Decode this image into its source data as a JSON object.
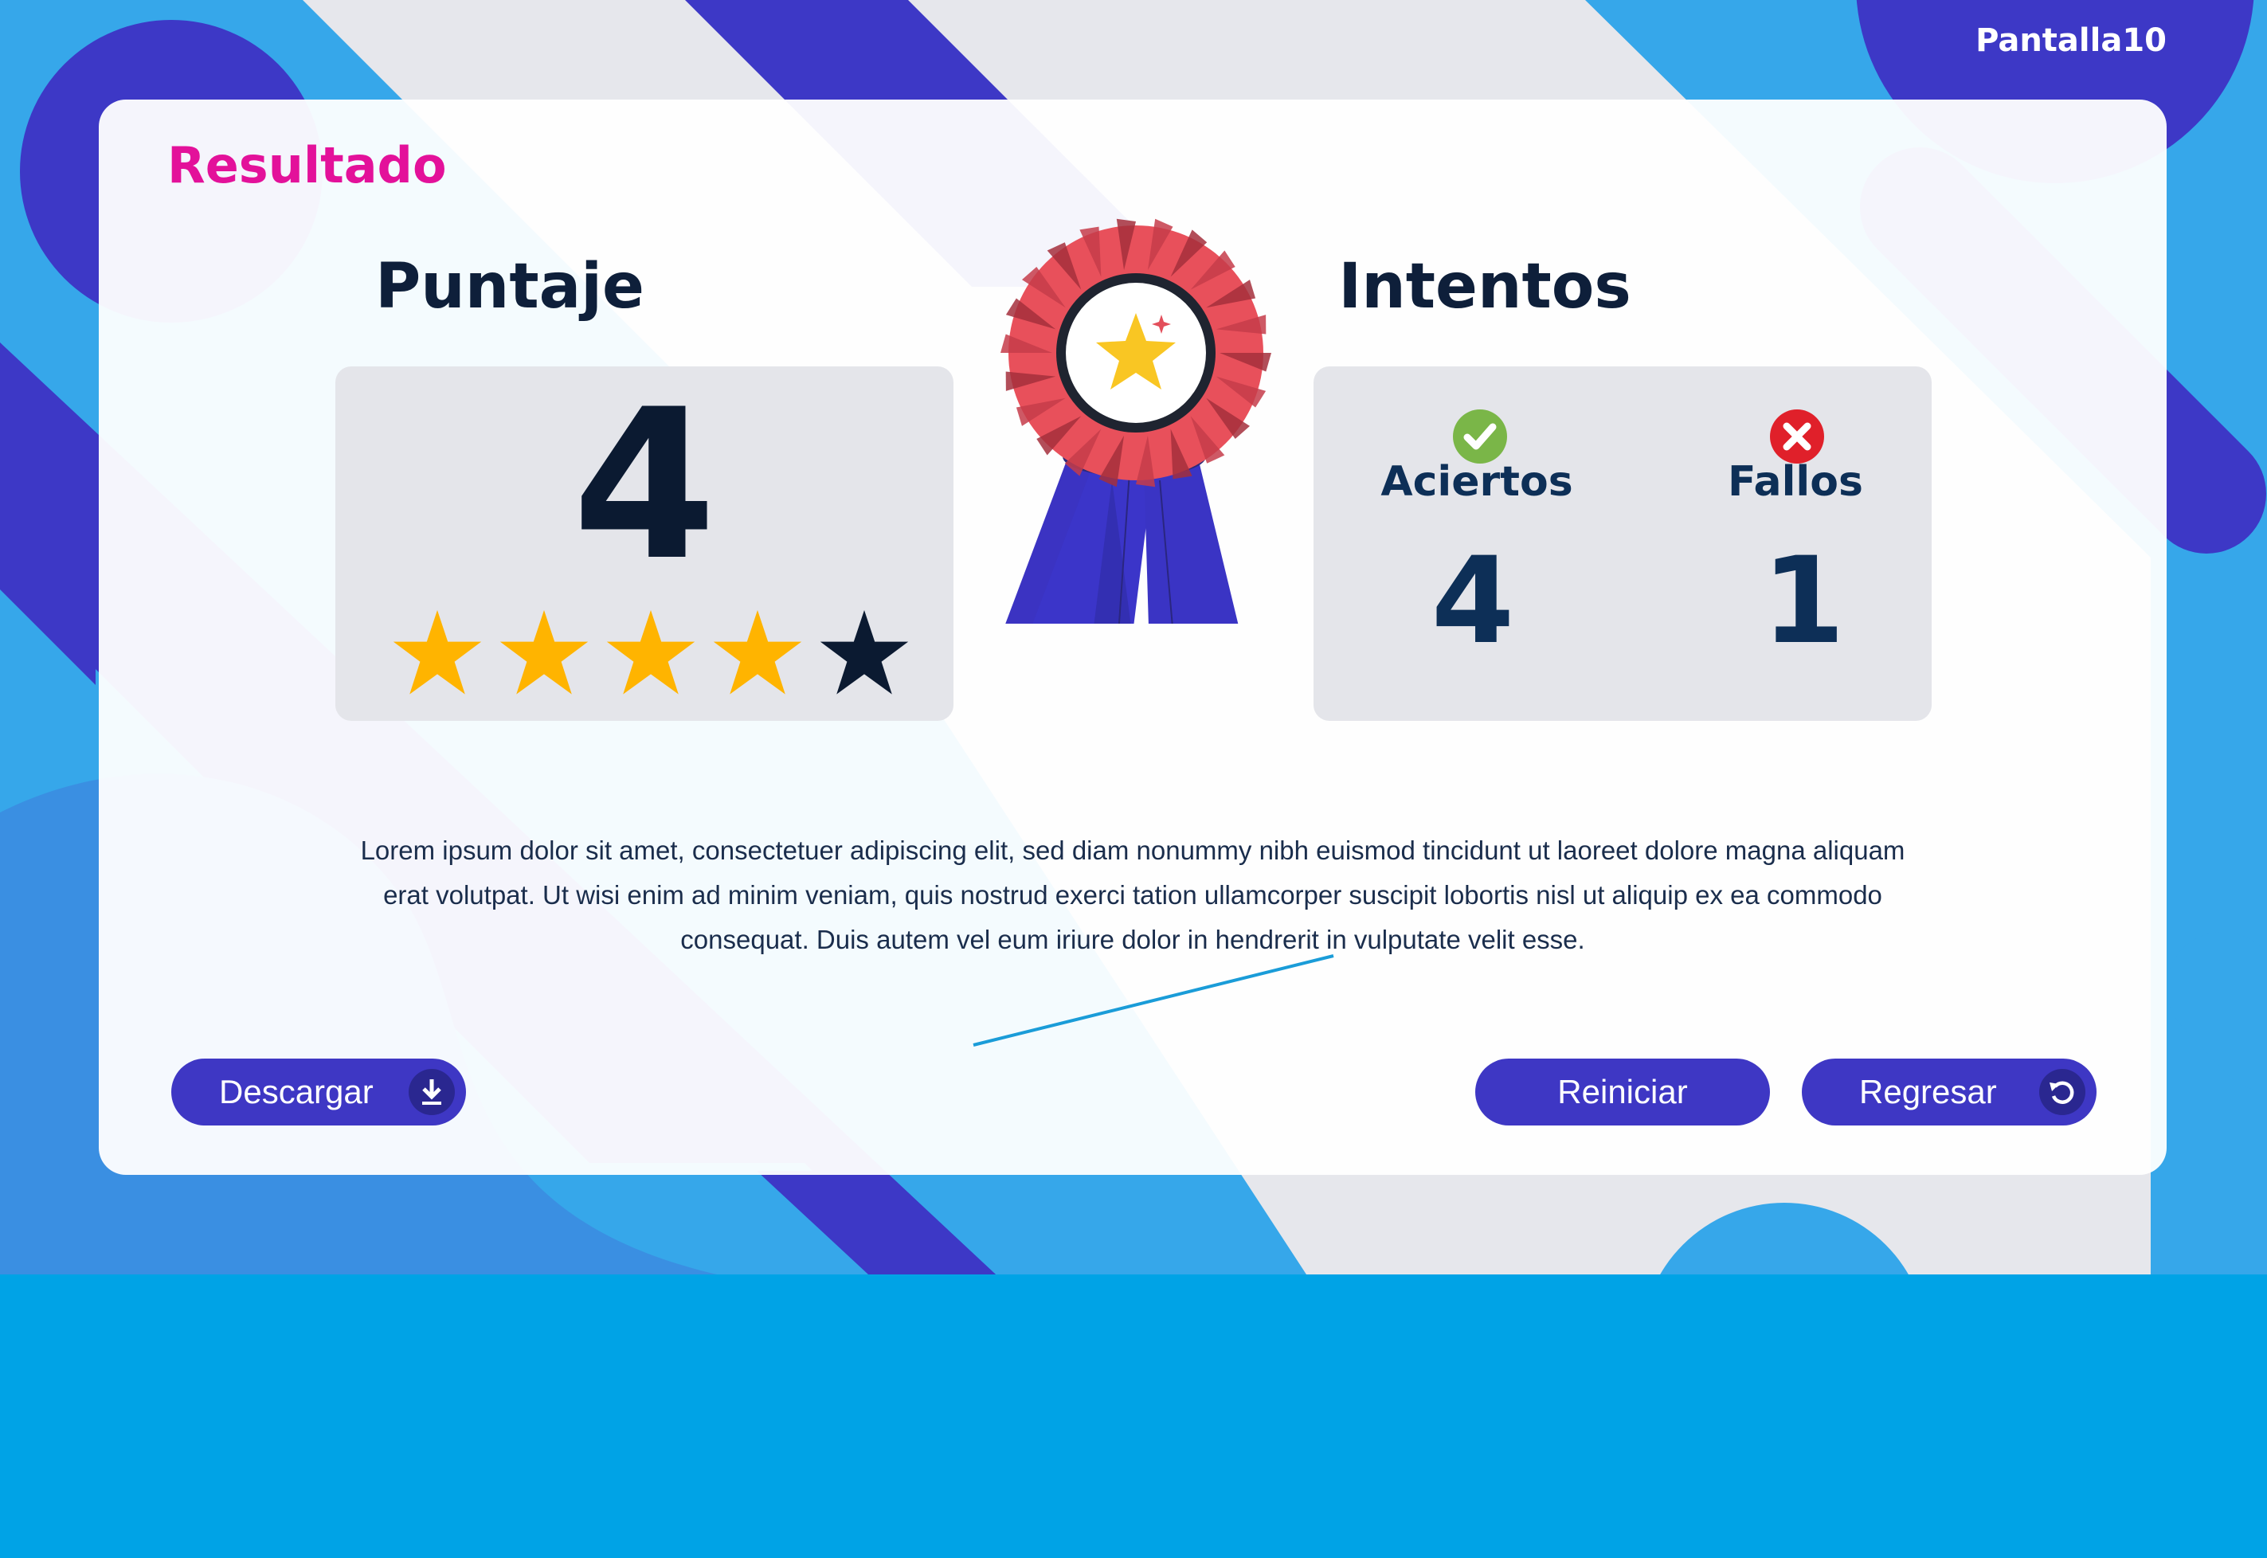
{
  "screen": {
    "label": "Pantalla10"
  },
  "card": {
    "title": "Resultado"
  },
  "score": {
    "title": "Puntaje",
    "value": "4",
    "stars_filled": 4,
    "stars_total": 5,
    "star_filled_color": "#ffb400",
    "star_empty_color": "#0b1a31"
  },
  "attempts": {
    "title": "Intentos",
    "correct": {
      "label": "Aciertos",
      "value": "4",
      "icon": "check-circle-icon",
      "color": "#7ab648"
    },
    "wrong": {
      "label": "Fallos",
      "value": "1",
      "icon": "x-circle-icon",
      "color": "#e0202a"
    }
  },
  "award": {
    "icon": "award-ribbon-icon"
  },
  "message": "Lorem ipsum dolor sit amet, consectetuer adipiscing elit, sed diam nonummy nibh euismod tincidunt ut laoreet dolore magna aliquam erat volutpat. Ut wisi enim ad minim veniam, quis nostrud exerci tation ullamcorper suscipit lobortis nisl ut aliquip ex ea commodo consequat. Duis autem vel eum iriure dolor in hendrerit in vulputate velit esse.",
  "buttons": {
    "download": {
      "label": "Descargar",
      "icon": "download-icon"
    },
    "restart": {
      "label": "Reiniciar"
    },
    "back": {
      "label": "Regresar",
      "icon": "undo-icon"
    }
  },
  "colors": {
    "accent": "#3e37c4",
    "title_pink": "#e3119a",
    "sky_blue": "#36a7ea",
    "bottom_band": "#00a3e6"
  }
}
